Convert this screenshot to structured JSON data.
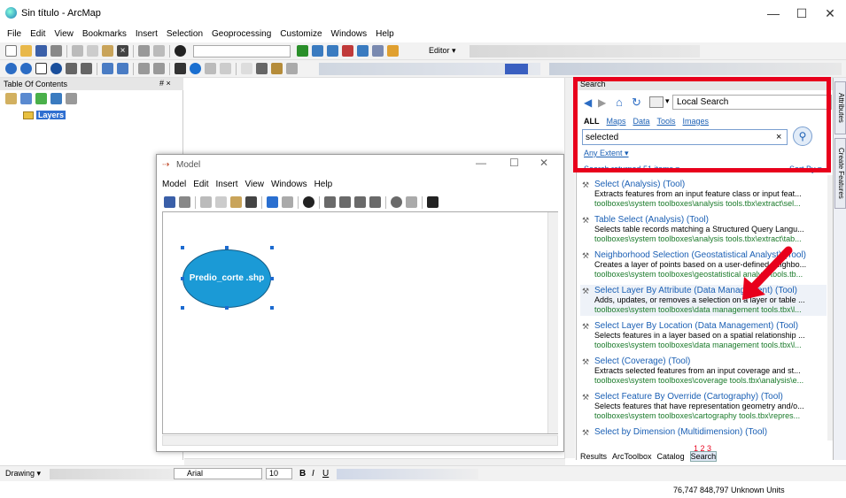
{
  "window": {
    "title": "Sin título - ArcMap"
  },
  "menu": [
    "File",
    "Edit",
    "View",
    "Bookmarks",
    "Insert",
    "Selection",
    "Geoprocessing",
    "Customize",
    "Windows",
    "Help"
  ],
  "editor_label": "Editor ▾",
  "toc": {
    "title": "Table Of Contents",
    "pin": "# ×",
    "layer": "Layers"
  },
  "model": {
    "title": "Model",
    "menu": [
      "Model",
      "Edit",
      "Insert",
      "View",
      "Windows",
      "Help"
    ],
    "element_label": "Predio_corte .shp"
  },
  "search": {
    "title": "Search",
    "scope": "Local Search",
    "filters": [
      "ALL",
      "Maps",
      "Data",
      "Tools",
      "Images"
    ],
    "query": "selected",
    "extent": "Any Extent ▾",
    "returned": "Search returned 51 items ▾",
    "sort": "Sort By ▾",
    "results": [
      {
        "title": "Select (Analysis) (Tool)",
        "desc": "Extracts features from an input feature class or input feat...",
        "path": "toolboxes\\system toolboxes\\analysis tools.tbx\\extract\\sel..."
      },
      {
        "title": "Table Select (Analysis) (Tool)",
        "desc": "Selects table records matching a Structured Query Langu...",
        "path": "toolboxes\\system toolboxes\\analysis tools.tbx\\extract\\tab..."
      },
      {
        "title": "Neighborhood Selection (Geostatistical Analyst) (Tool)",
        "desc": "Creates a layer of points based on a user-defined neighbo...",
        "path": "toolboxes\\system toolboxes\\geostatistical analyst tools.tb..."
      },
      {
        "title": "Select Layer By Attribute (Data Management) (Tool)",
        "desc": "Adds, updates, or removes a selection on a layer or table ...",
        "path": "toolboxes\\system toolboxes\\data management tools.tbx\\l..."
      },
      {
        "title": "Select Layer By Location (Data Management) (Tool)",
        "desc": "Selects features in a layer based on a spatial relationship ...",
        "path": "toolboxes\\system toolboxes\\data management tools.tbx\\l..."
      },
      {
        "title": "Select (Coverage) (Tool)",
        "desc": "Extracts selected features from an input coverage and st...",
        "path": "toolboxes\\system toolboxes\\coverage tools.tbx\\analysis\\e..."
      },
      {
        "title": "Select Feature By Override (Cartography) (Tool)",
        "desc": "Selects features that have representation geometry and/o...",
        "path": "toolboxes\\system toolboxes\\cartography tools.tbx\\repres..."
      },
      {
        "title": "Select by Dimension (Multidimension) (Tool)",
        "desc": "",
        "path": ""
      }
    ],
    "pages": "1 2 3",
    "bottom_tabs": [
      "Results",
      "ArcToolbox",
      "Catalog",
      "Search"
    ]
  },
  "side_tabs": [
    "Attributes",
    "Create Features"
  ],
  "drawing": {
    "label": "Drawing ▾",
    "font": "Arial",
    "size": "10"
  },
  "status": {
    "coords": "76,747  848,797 Unknown Units"
  }
}
